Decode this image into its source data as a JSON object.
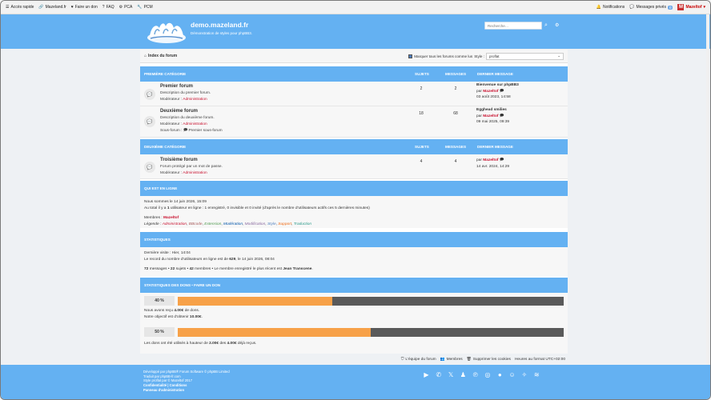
{
  "topbar": {
    "left": [
      {
        "icon": "menu-icon",
        "label": "Accès rapide"
      },
      {
        "icon": "link-icon",
        "label": "Mazeland.fr"
      },
      {
        "icon": "heart-icon",
        "label": "Faire un don"
      },
      {
        "icon": "question-icon",
        "label": "FAQ"
      },
      {
        "icon": "users-icon",
        "label": "PCA"
      },
      {
        "icon": "wrench-icon",
        "label": "PCM"
      }
    ],
    "notifications": "Notifications",
    "messages": "Messages privés",
    "messages_count": "0",
    "avatar_letter": "M",
    "username": "Mazeltof"
  },
  "header": {
    "title": "demo.mazeland.fr",
    "description": "Démonstration de styles pour phpBB3.",
    "search_placeholder": "Recherche…"
  },
  "navbar": {
    "index": "Index du forum",
    "mark_read": "Marquer tous les forums comme lus",
    "style_label": "Style :",
    "style_value": "proflat"
  },
  "columns": {
    "topics": "SUJETS",
    "posts": "MESSAGES",
    "last": "DERNIER MESSAGE"
  },
  "categories": [
    {
      "name": "PREMIÈRE CATÉGORIE",
      "forums": [
        {
          "title": "Premier forum",
          "desc": "Description du premier forum.",
          "mod_label": "Modérateur :",
          "mod": "Administration",
          "subforum_label": "",
          "subforum": "",
          "topics": "2",
          "posts": "2",
          "last_title": "Bienvenue sur phpBB3",
          "last_by": "par",
          "last_user": "Mazeltof",
          "last_date": "03 août 2023, 14:58"
        },
        {
          "title": "Deuxième forum",
          "desc": "Description du deuxième forum.",
          "mod_label": "Modérateur :",
          "mod": "Administration",
          "subforum_label": "Sous-forum :",
          "subforum": "Premier sous-forum",
          "topics": "18",
          "posts": "68",
          "last_title": "Egghead smilies",
          "last_by": "par",
          "last_user": "Mazeltof",
          "last_date": "09 mai 2025, 09:39"
        }
      ]
    },
    {
      "name": "DEUXIÈME CATÉGORIE",
      "forums": [
        {
          "title": "Troisième forum",
          "desc": "Forum protégé par un mot de passe.",
          "mod_label": "Modérateur :",
          "mod": "Administration",
          "topics": "4",
          "posts": "4",
          "last_title": "",
          "last_by": "par",
          "last_user": "Mazeltof",
          "last_date": "14 avr. 2024, 14:29"
        }
      ]
    }
  ],
  "online": {
    "title": "QUI EST EN LIGNE",
    "line1": "Nous sommes le 14 juin 2026, 15:09",
    "line2_prefix": "Au total il y a",
    "line2_count": "1",
    "line2_rest": "utilisateur en ligne : 1 enregistré, 0 invisible et 0 invité (d'après le nombre d'utilisateurs actifs ces 5 dernières minutes)",
    "members_label": "Membres :",
    "members": "Mazeltof",
    "legend_label": "Légende :",
    "legend": [
      "Administration",
      "BBcode",
      "Extension",
      "Modération",
      "Modification",
      "Style",
      "Support",
      "Traduction"
    ]
  },
  "stats": {
    "title": "STATISTIQUES",
    "last_visit": "Dernière visite : Hier, 14:04",
    "record_prefix": "Le record du nombre d'utilisateurs en ligne est de",
    "record_count": "629",
    "record_suffix": ", le 14 juin 2026, 08:04",
    "messages_count": "72",
    "messages_label": "messages •",
    "topics_count": "22",
    "topics_label": "sujets •",
    "members_count": "42",
    "members_label": "membres • Le membre enregistré le plus récent est",
    "newest": "Jean Transcene",
    "period": "."
  },
  "donations": {
    "title": "STATISTIQUES DES DONS • FAIRE UN DON",
    "bar1_label": "40 %",
    "bar1_value": 0.4,
    "received_prefix": "Nous avons reçu",
    "received_amount": "4.00€",
    "received_suffix": "de dons.",
    "goal_prefix": "Notre objectif est d'obtenir",
    "goal_amount": "10.00€",
    "goal_suffix": ".",
    "bar2_label": "50 %",
    "bar2_value": 0.5,
    "used_prefix": "Les dons ont été utilisés à hauteur de",
    "used_amount": "2.00€",
    "used_mid": "des",
    "used_total": "4.00€",
    "used_suffix": "déjà reçus."
  },
  "footer_links": {
    "team": "L'équipe du forum",
    "members": "Membres",
    "cookies": "Supprimer les cookies",
    "timezone": "Heures au format UTC+02:00"
  },
  "credits": {
    "line1": "Développé par phpBB® Forum Software © phpBB Limited",
    "line2": "Traduit par phpBB-fr.com",
    "line3": "Style proflat par © Mazeltof 2017",
    "line4": "Confidentialité | Conditions",
    "line5": "Panneau d'administration"
  },
  "social_icons": [
    "youtube-icon",
    "whatsapp-icon",
    "x-icon",
    "snapchat-icon",
    "pinterest-icon",
    "instagram-icon",
    "github-icon",
    "discord-icon",
    "bluesky-icon",
    "rss-icon"
  ],
  "colors": {
    "accent": "#64b1f2",
    "donation_fill": "#f7a148",
    "donation_track": "#5a5a5a",
    "admin_red": "#c8102e"
  }
}
